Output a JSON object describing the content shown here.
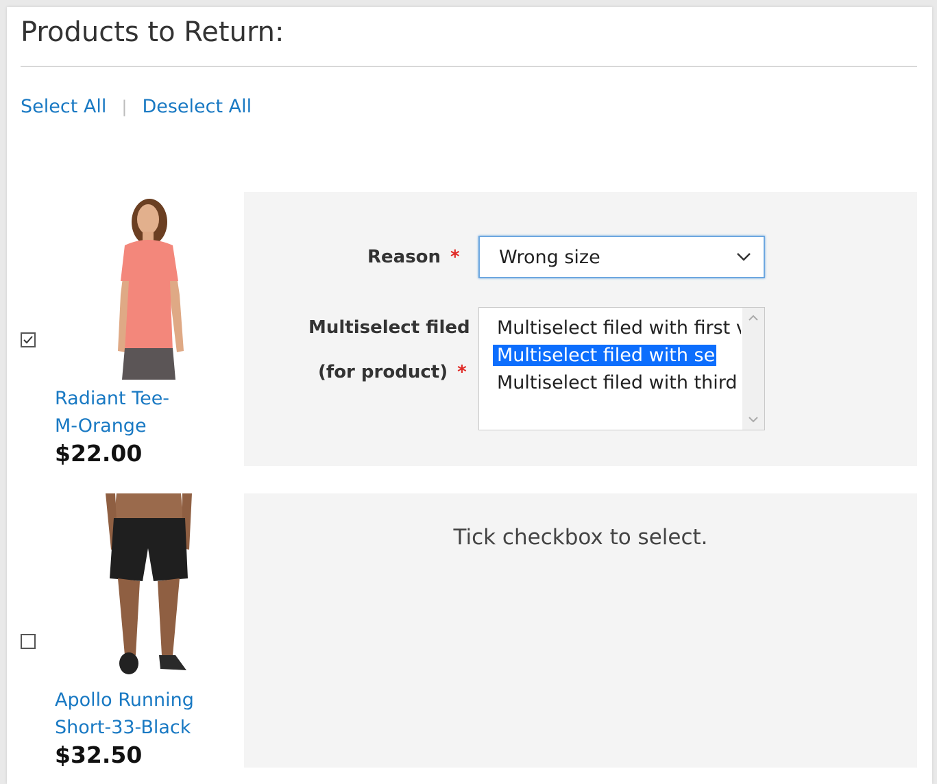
{
  "page": {
    "title": "Products to Return:"
  },
  "actions": {
    "select_all": "Select All",
    "separator": "|",
    "deselect_all": "Deselect All"
  },
  "products": [
    {
      "name_line1": "Radiant Tee-",
      "name_line2": "M-Orange",
      "price": "$22.00",
      "checked": true,
      "image_icon": "orange-tee-model-image"
    },
    {
      "name_line1": "Apollo Running",
      "name_line2": "Short-33-Black",
      "price": "$32.50",
      "checked": false,
      "image_icon": "black-shorts-model-image"
    }
  ],
  "form": {
    "reason_label": "Reason",
    "required_mark": "*",
    "reason_value": "Wrong size",
    "multiselect_label_line1": "Multiselect filed",
    "multiselect_label_line2": "(for product)",
    "multiselect_options": [
      "Multiselect filed with first va",
      "Multiselect filed with se",
      "Multiselect filed with third v"
    ],
    "multiselect_selected_index": 1
  },
  "hint": {
    "text": "Tick checkbox to select."
  },
  "colors": {
    "link": "#1979c3",
    "required": "#e02b27",
    "selection": "#0d6efd",
    "panel": "#f4f4f4"
  }
}
